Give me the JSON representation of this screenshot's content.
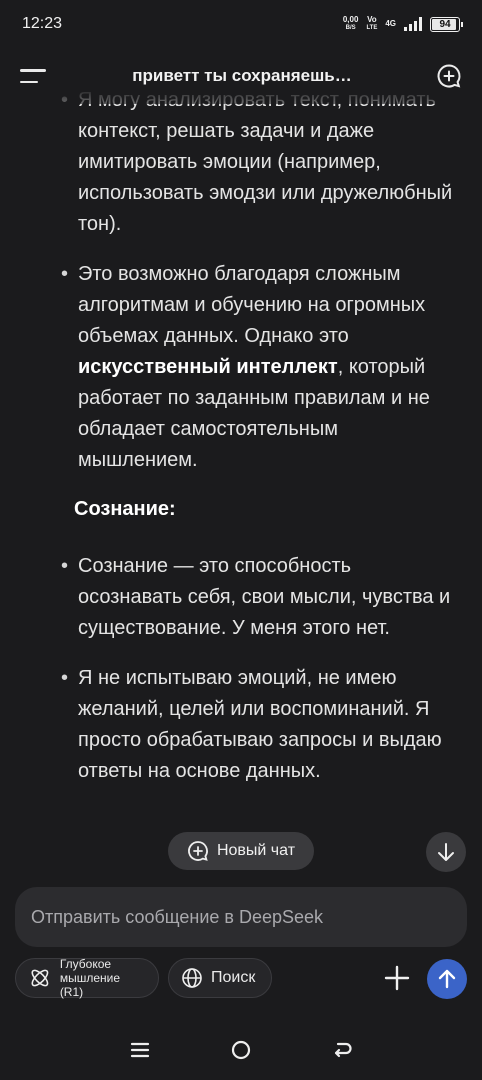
{
  "status_bar": {
    "time": "12:23",
    "net_speed_value": "0,00",
    "net_speed_unit": "B/S",
    "vo_top": "Vo",
    "vo_bottom": "LTE",
    "network": "4G",
    "battery": "94"
  },
  "header": {
    "title": "приветт ты сохраняешь…"
  },
  "content": {
    "bullets_top": [
      {
        "text": "Я могу анализировать текст, понимать контекст, решать задачи и даже имитировать эмоции (например, использовать эмодзи или дружелюбный тон)."
      }
    ],
    "bullet_ai": {
      "before": "Это возможно благодаря сложным алгоритмам и обучению на огромных объемах данных. Однако это ",
      "bold": "искусственный интеллект",
      "after": ", который работает по заданным правилам и не обладает самостоятельным мышлением."
    },
    "heading": "Сознание:",
    "bullets_consciousness": [
      "Сознание — это способность осознавать себя, свои мысли, чувства и существование. У меня этого нет.",
      "Я не испытываю эмоций, не имею желаний, целей или воспоминаний. Я просто обрабатываю запросы и выдаю ответы на основе данных."
    ]
  },
  "floating": {
    "new_chat_label": "Новый чат"
  },
  "input": {
    "placeholder": "Отправить сообщение в DeepSeek"
  },
  "toolbar": {
    "deep_think_label_line1": "Глубокое",
    "deep_think_label_line2": "мышление (R1)",
    "search_label": "Поиск"
  },
  "colors": {
    "background": "#1b1b1d",
    "send_button": "#3b64c8",
    "chip_bg": "#262629"
  }
}
